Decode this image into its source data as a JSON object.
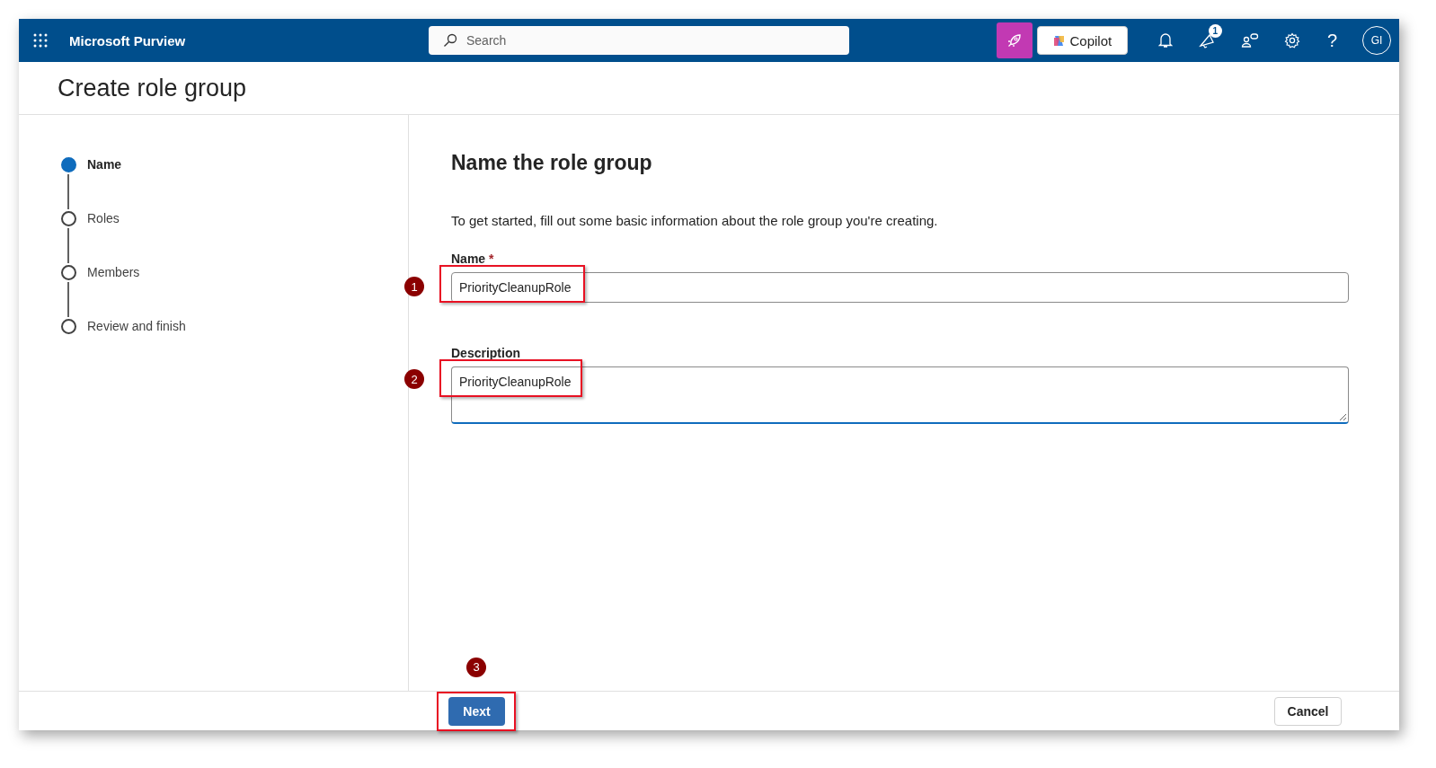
{
  "header": {
    "app_name": "Microsoft Purview",
    "search": {
      "placeholder": "Search"
    },
    "copilot": "Copilot",
    "notification_count": "1",
    "help": "?",
    "avatar": "GI"
  },
  "page_title": "Create role group",
  "steps": [
    {
      "label": "Name",
      "selected": true
    },
    {
      "label": "Roles",
      "selected": false
    },
    {
      "label": "Members",
      "selected": false
    },
    {
      "label": "Review and finish",
      "selected": false
    }
  ],
  "form": {
    "heading": "Name the role group",
    "intro": "To get started, fill out some basic information about the role group you're creating.",
    "name": {
      "label": "Name",
      "required_mark": "*",
      "value": "PriorityCleanupRole",
      "annotation": "1"
    },
    "description": {
      "label": "Description",
      "value": "PriorityCleanupRole",
      "annotation": "2"
    }
  },
  "footer": {
    "next": "Next",
    "next_annotation": "3",
    "cancel": "Cancel"
  }
}
